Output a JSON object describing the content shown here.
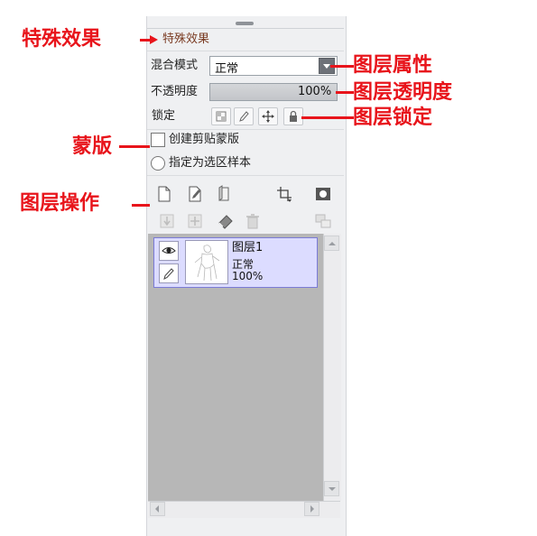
{
  "panel": {
    "fx_label": "特殊效果",
    "blend_label": "混合模式",
    "blend_value": "正常",
    "opacity_label": "不透明度",
    "opacity_value": "100%",
    "lock_label": "锁定",
    "clip_label": "创建剪贴蒙版",
    "ref_label": "指定为选区样本",
    "layer": {
      "name": "图层1",
      "mode": "正常",
      "opacity": "100%"
    }
  },
  "annotations": {
    "effects": "特殊效果",
    "properties": "图层属性",
    "opacity": "图层透明度",
    "lock": "图层锁定",
    "mask": "蒙版",
    "operations": "图层操作"
  },
  "colors": {
    "annotation": "#e8141b",
    "layer_selected": "#dcdcff",
    "layer_border": "#7b7bd6",
    "list_bg": "#b7b7b7"
  }
}
